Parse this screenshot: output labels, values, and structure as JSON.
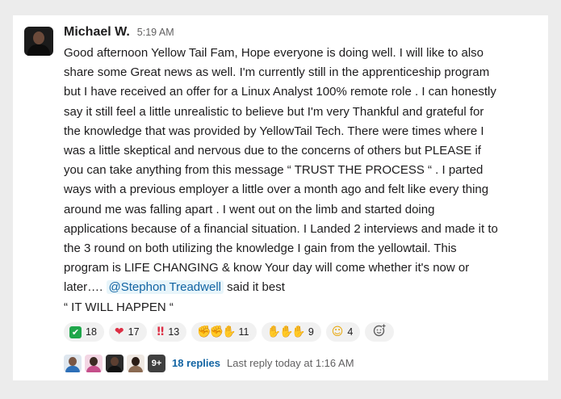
{
  "message": {
    "author": "Michael W.",
    "time": "5:19 AM",
    "body_pre": "Good afternoon Yellow Tail Fam, Hope everyone is doing well. I will like to also\nshare some Great news as well. I'm currently still in the apprenticeship program\nbut I have received an offer for a Linux Analyst 100% remote role . I can honestly\nsay it still feel a little unrealistic to believe but  I'm very Thankful and grateful for\nthe knowledge that was provided by YellowTail Tech. There were times where I\nwas a little skeptical and nervous due to the concerns of others but PLEASE if\nyou can take anything from this message “ TRUST THE PROCESS “ .  I parted\nways with a previous employer a little over a month ago and felt like every thing\naround me was falling apart . I went out on the limb and started doing\napplications because of a financial situation. I Landed 2 interviews and made it to\nthe 3 round on both utilizing the knowledge I gain from the yellowtail. This\nprogram is LIFE CHANGING & know Your day will come whether it's  now or\nlater…. ",
    "mention": "@Stephon Treadwell",
    "body_post": "  said it best\n“ IT WILL HAPPEN “"
  },
  "reactions": [
    {
      "icon": "white-check-mark-emoji",
      "glyph": "✔",
      "count": "18"
    },
    {
      "icon": "heart-emoji",
      "glyph": "❤",
      "count": "17"
    },
    {
      "icon": "double-exclamation-emoji",
      "glyph": "‼",
      "count": "13"
    },
    {
      "icon": "clapping-hands-emoji",
      "glyph": "✊✊✋",
      "count": "11"
    },
    {
      "icon": "raised-hands-emoji",
      "glyph": "✋✋✋",
      "count": "9"
    },
    {
      "icon": "party-face-emoji",
      "glyph": "☺",
      "count": "4"
    }
  ],
  "add_reaction_icon": "add-reaction-icon",
  "thread": {
    "more_count": "9+",
    "replies": "18 replies",
    "last_reply": "Last reply today at 1:16 AM"
  },
  "colors": {
    "mention_text": "#1264a3",
    "mention_bg": "#e8f5fa",
    "link": "#1264a3",
    "muted": "#616061",
    "text": "#1d1c1d",
    "reaction_bg": "#f1f1f1",
    "page_bg": "#ececec"
  }
}
